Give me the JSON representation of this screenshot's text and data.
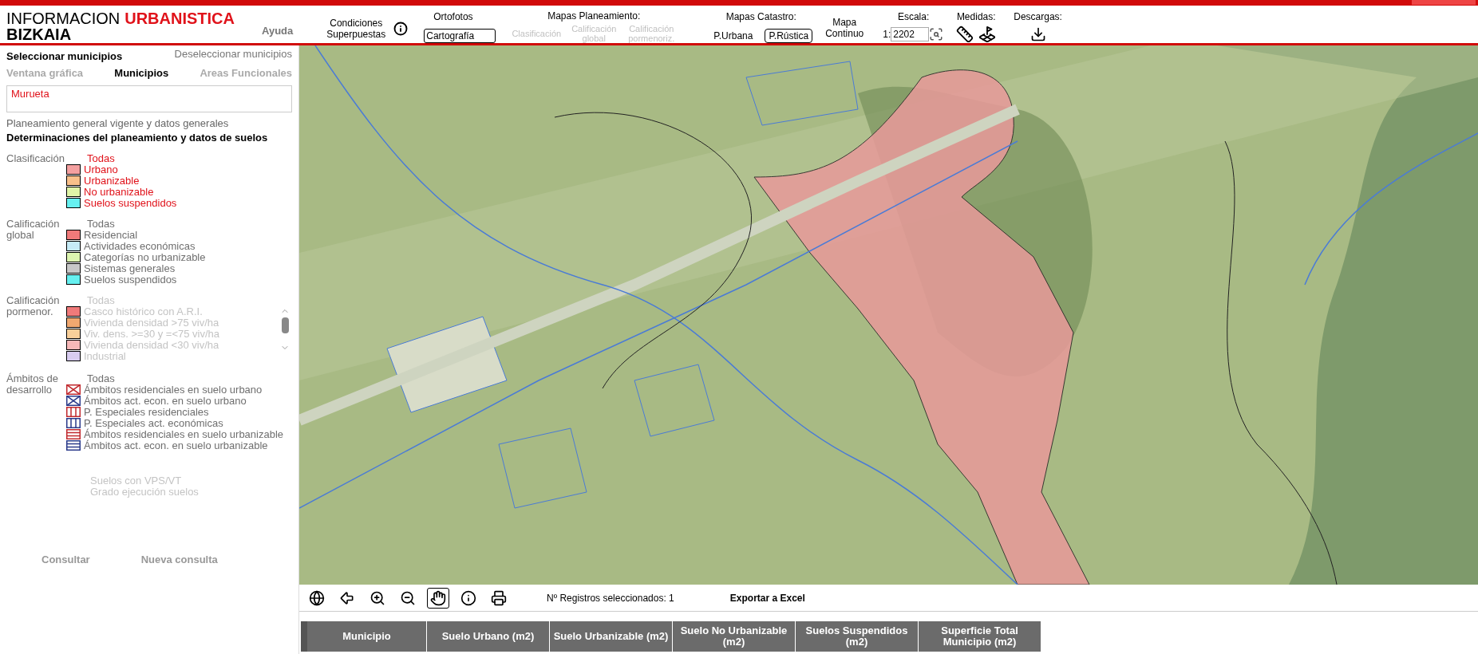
{
  "header": {
    "title": "INFORMACION",
    "title_accent": "URBANISTICA",
    "subtitle": "BIZKAIA",
    "help": "Ayuda"
  },
  "toolbar": {
    "conditions": "Condiciones Superpuestas",
    "ortofotos": {
      "label": "Ortofotos",
      "value": "Cartografía"
    },
    "planeamiento": {
      "label": "Mapas Planeamiento:",
      "items": [
        {
          "label": "Clasificación",
          "disabled": true
        },
        {
          "label": "Calificación global",
          "disabled": true
        },
        {
          "label": "Calificación pormenoriz.",
          "disabled": true
        }
      ]
    },
    "catastro": {
      "label": "Mapas Catastro:",
      "items": [
        {
          "label": "P.Urbana",
          "selected": false
        },
        {
          "label": "P.Rústica",
          "selected": true
        }
      ]
    },
    "continuo": "Mapa Continuo",
    "escala": {
      "label": "Escala:",
      "prefix": "1:",
      "value": "2202"
    },
    "medidas": {
      "label": "Medidas:"
    },
    "descargas": {
      "label": "Descargas:"
    }
  },
  "sidebar": {
    "select_title": "Seleccionar municipios",
    "deselect": "Deseleccionar municipios",
    "tabs": [
      {
        "label": "Ventana gráfica",
        "selected": false
      },
      {
        "label": "Municipios",
        "selected": true
      },
      {
        "label": "Areas Funcionales",
        "selected": false
      }
    ],
    "municipios": [
      "Murueta"
    ],
    "general_link": "Planeamiento general vigente y datos generales",
    "determinaciones": "Determinaciones del planeamiento y datos de suelos",
    "sections": [
      {
        "label": "Clasificación",
        "active": true,
        "disabled": false,
        "scroll": false,
        "all": "Todas",
        "items": [
          {
            "label": "Urbano",
            "kind": "fill",
            "color": "#f4a0a0"
          },
          {
            "label": "Urbanizable",
            "kind": "fill",
            "color": "#f9c08a"
          },
          {
            "label": "No urbanizable",
            "kind": "fill",
            "color": "#e0f5a8"
          },
          {
            "label": "Suelos suspendidos",
            "kind": "fill",
            "color": "#66f0f0"
          }
        ]
      },
      {
        "label": "Calificación global",
        "active": false,
        "disabled": false,
        "scroll": false,
        "all": "Todas",
        "items": [
          {
            "label": "Residencial",
            "kind": "fill",
            "color": "#f07a7a"
          },
          {
            "label": "Actividades económicas",
            "kind": "fill",
            "color": "#c6ebf7"
          },
          {
            "label": "Categorías no urbanizable",
            "kind": "fill",
            "color": "#ddf5b0"
          },
          {
            "label": "Sistemas generales",
            "kind": "fill",
            "color": "#c8c8c8"
          },
          {
            "label": "Suelos suspendidos",
            "kind": "fill",
            "color": "#66f0f0"
          }
        ]
      },
      {
        "label": "Calificación pormenor.",
        "active": false,
        "disabled": true,
        "scroll": true,
        "all": "Todas",
        "items": [
          {
            "label": "Casco histórico con A.R.I.",
            "kind": "fill",
            "color": "#f07a7a"
          },
          {
            "label": "Vivienda densidad >75 viv/ha",
            "kind": "fill",
            "color": "#f0a870"
          },
          {
            "label": "Viv. dens. >=30 y =<75 viv/ha",
            "kind": "fill",
            "color": "#f9d09a"
          },
          {
            "label": "Vivienda densidad <30 viv/ha",
            "kind": "fill",
            "color": "#f7b8b8"
          },
          {
            "label": "Industrial",
            "kind": "fill",
            "color": "#d8ccf0"
          }
        ]
      },
      {
        "label": "Ámbitos de desarrollo",
        "active": false,
        "disabled": false,
        "scroll": false,
        "all": "Todas",
        "items": [
          {
            "label": "Ámbitos residenciales en suelo urbano",
            "kind": "cross",
            "color": "#c0282d"
          },
          {
            "label": "Ámbitos act. econ. en suelo urbano",
            "kind": "cross",
            "color": "#2a3a8a"
          },
          {
            "label": "P. Especiales residenciales",
            "kind": "vertical",
            "color": "#c0282d"
          },
          {
            "label": "P. Especiales act. económicas",
            "kind": "vertical",
            "color": "#2a3a8a"
          },
          {
            "label": "Ámbitos residenciales en suelo urbanizable",
            "kind": "horizontal",
            "color": "#c0282d"
          },
          {
            "label": "Ámbitos act. econ. en suelo urbanizable",
            "kind": "horizontal",
            "color": "#2a3a8a"
          }
        ]
      }
    ],
    "extras": [
      {
        "label": "Suelos con VPS/VT",
        "disabled": true
      },
      {
        "label": "Grado ejecución suelos",
        "disabled": true
      }
    ],
    "buttons": [
      "Consultar",
      "Nueva consulta"
    ]
  },
  "map_tools": [
    {
      "kind": "globe",
      "selected": false
    },
    {
      "kind": "back",
      "selected": false
    },
    {
      "kind": "zoom-in",
      "selected": false
    },
    {
      "kind": "zoom-out",
      "selected": false
    },
    {
      "kind": "pan",
      "selected": true
    },
    {
      "kind": "info",
      "selected": false
    },
    {
      "kind": "print",
      "selected": false
    }
  ],
  "status": {
    "records": "Nº Registros seleccionados: 1",
    "export": "Exportar a Excel"
  },
  "table": {
    "columns": [
      "Municipio",
      "Suelo Urbano (m2)",
      "Suelo Urbanizable (m2)",
      "Suelo No Urbanizable (m2)",
      "Suelos Suspendidos (m2)",
      "Superficie Total Municipio (m2)"
    ]
  }
}
